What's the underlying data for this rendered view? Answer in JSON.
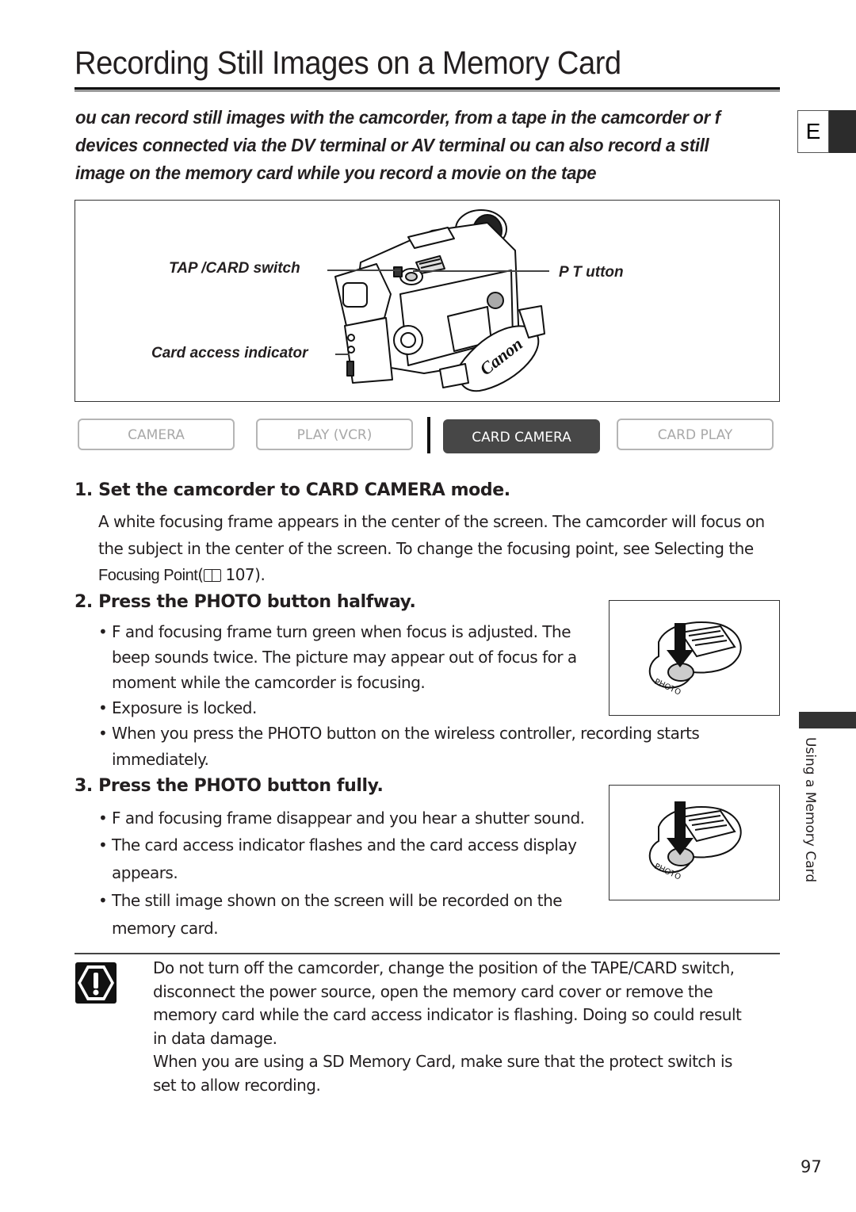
{
  "page": {
    "title": "Recording Still Images on a Memory Card",
    "language_tab": "E",
    "page_number": "97",
    "side_tab_label": "Using a Memory Card"
  },
  "intro": {
    "lines": [
      " ou can record still images with the camcorder, from a tape in the camcorder or f",
      "devices connected via the DV terminal or AV terminal    ou can also record a still",
      "image on the memory card while you record a movie on the tape"
    ]
  },
  "figure": {
    "callouts": {
      "tape_card_switch": "TAP   /CARD switch",
      "photo_button": "P      T       utton",
      "card_access_indicator": "Card access indicator"
    },
    "brand_label": "Canon"
  },
  "modes": {
    "items": [
      {
        "label": "CAMERA",
        "active": false
      },
      {
        "label": "PLAY (VCR)",
        "active": false
      },
      {
        "label": "CARD CAMERA",
        "active": true
      },
      {
        "label": "CARD PLAY",
        "active": false
      }
    ]
  },
  "steps": [
    {
      "heading": "1. Set the camcorder to CARD CAMERA mode.",
      "lines": [
        "A white focusing frame appears in the center of the screen. The camcorder will focus on",
        "the subject in the center of the screen. To change the focusing point, see Selecting the"
      ],
      "ref_text": "Focusing Point",
      "ref_page": " 107)."
    },
    {
      "heading": "2. Press the PHOTO button halfway.",
      "bullets": [
        [
          "F  and focusing frame turn green when focus is adjusted. The",
          "beep sounds twice. The picture may appear out of focus for a",
          "moment while the camcorder is focusing."
        ],
        [
          "Exposure is locked."
        ],
        [
          "When you press the PHOTO button on the wireless controller, recording starts",
          "immediately."
        ]
      ],
      "illustration_label": "PHOTO"
    },
    {
      "heading": "3. Press the PHOTO button fully.",
      "bullets": [
        [
          "F  and focusing frame disappear and you hear a shutter sound."
        ],
        [
          "The card access indicator flashes and the card access display",
          "appears."
        ],
        [
          "The still image shown on the screen will be recorded on the",
          "memory card."
        ]
      ],
      "illustration_label": "PHOTO"
    }
  ],
  "caution": {
    "lines": [
      "Do not turn off the camcorder, change the position of the TAPE/CARD switch,",
      "disconnect the power source, open the memory card cover or remove the",
      "memory card while the card access indicator is flashing. Doing so could result",
      "in data damage.",
      "When you are using a SD Memory Card, make sure that the protect switch is",
      "set to allow recording."
    ]
  }
}
